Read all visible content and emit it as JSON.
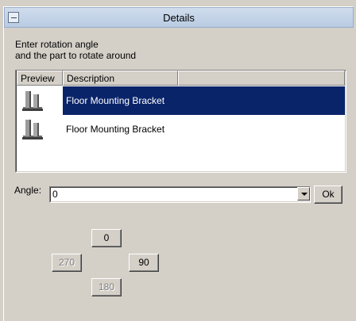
{
  "header": {
    "title": "Details",
    "collapse_icon": "minus-box-icon"
  },
  "instructions": {
    "line1": "Enter rotation angle",
    "line2": "and the part to rotate around"
  },
  "list": {
    "columns": [
      "Preview",
      "Description"
    ],
    "rows": [
      {
        "description": "Floor Mounting Bracket",
        "selected": true,
        "preview_icon": "bracket-part-icon"
      },
      {
        "description": "Floor Mounting Bracket",
        "selected": false,
        "preview_icon": "bracket-part-icon"
      }
    ]
  },
  "angle": {
    "label": "Angle:",
    "value": "0",
    "ok_label": "Ok"
  },
  "rotate_buttons": {
    "up": "0",
    "left": "270",
    "right": "90",
    "down": "180"
  },
  "colors": {
    "selection": "#0a246a",
    "header": "#c5d5ea",
    "window": "#d4d0c8"
  }
}
